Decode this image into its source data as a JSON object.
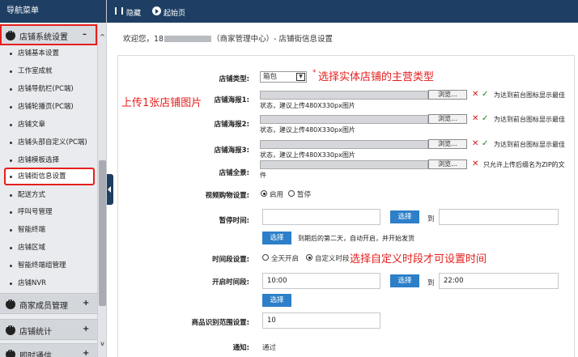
{
  "sidebar": {
    "header": "导航菜单",
    "active_group": "店铺系统设置",
    "active_group_toggle": "–",
    "items": [
      "店铺基本设置",
      "工作室成就",
      "店铺导航栏(PC端)",
      "店铺轮播页(PC端)",
      "店铺文章",
      "店铺头部自定义(PC端)",
      "店铺模板选择",
      "店铺街信息设置",
      "配送方式",
      "呼叫号管理",
      "智能终端",
      "店铺区域",
      "智能终端组管理",
      "店铺NVR"
    ],
    "active_item": "店铺街信息设置",
    "groups": [
      {
        "label": "商家成员管理",
        "toggle": "+"
      },
      {
        "label": "店铺统计",
        "toggle": "+"
      },
      {
        "label": "即时通信",
        "toggle": "+"
      }
    ],
    "scroll_up": "^",
    "scroll_down": "v"
  },
  "topbar": {
    "hide": "隐藏",
    "home": "起始页"
  },
  "welcome": {
    "prefix": "欢迎您，18",
    "suffix": "（商家管理中心）- 店铺街信息设置"
  },
  "form": {
    "store_type_label": "店铺类型:",
    "store_type_value": "箱包",
    "store_type_arrow": "▼",
    "required_mark": "*",
    "store_type_annotation": "选择实体店铺的主营类型",
    "upload_annotation": "上传1张店铺图片",
    "poster1_label": "店铺海报1:",
    "poster2_label": "店铺海报2:",
    "poster3_label": "店铺海报3:",
    "panorama_label": "店铺全景:",
    "browse": "浏览...",
    "x": "✕",
    "check": "✓",
    "poster_tip": "为达到前台图标显示最佳",
    "poster_status": "状态，建议上传480X330px图片",
    "panorama_tip": "只允许上传后缀名为ZIP的文",
    "panorama_tip2": "件",
    "video_label": "视频购物设置:",
    "video_on": "启用",
    "video_off": "暂停",
    "pause_label": "暂停时间:",
    "select": "选择",
    "to": "到",
    "pause_note": "到期后的第二天，自动开启，并开始发货",
    "period_label": "时间段设置:",
    "period_all": "全天开启",
    "period_custom": "自定义时段",
    "period_annotation": "选择自定义时段才可设置时间",
    "open_label": "开启时间段:",
    "open_start": "10:00",
    "open_end": "22:00",
    "range_label": "商品识别范围设置:",
    "range_value": "10",
    "notify_label": "通知:",
    "notify_value": "通过"
  },
  "colors": {
    "nav": "#1e3f63",
    "button": "#2c7fc8",
    "highlight": "#e61e1e"
  }
}
